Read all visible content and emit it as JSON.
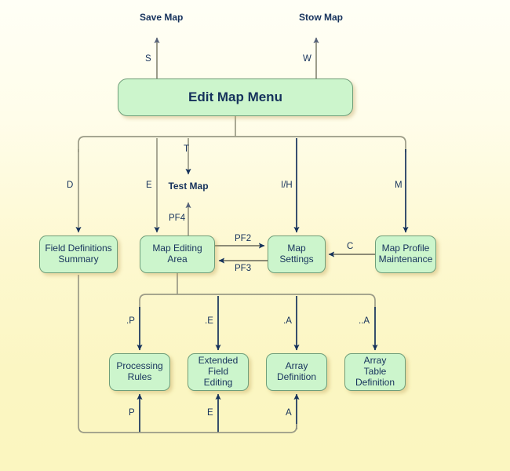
{
  "diagram": {
    "title": "Edit Map Menu navigation map",
    "colors": {
      "node_fill": "#ccf5cc",
      "node_border": "#6f9e7a",
      "text": "#16325c",
      "edge_dark": "#16325c",
      "edge_gray": "#9a9a86",
      "background_top": "#fffff6",
      "background_bottom": "#fbf6c0"
    },
    "terminals": [
      {
        "id": "save-map",
        "line1": "Save",
        "line2": "Map"
      },
      {
        "id": "stow-map",
        "line1": "Stow",
        "line2": "Map"
      },
      {
        "id": "test-map",
        "line1": "Test Map",
        "line2": ""
      }
    ],
    "nodes": [
      {
        "id": "edit-map-menu",
        "label": "Edit Map Menu"
      },
      {
        "id": "field-definitions-summary",
        "line1": "Field Definitions",
        "line2": "Summary"
      },
      {
        "id": "map-editing-area",
        "line1": "Map Editing",
        "line2": "Area"
      },
      {
        "id": "map-settings",
        "line1": "Map",
        "line2": "Settings"
      },
      {
        "id": "map-profile-maintenance",
        "line1": "Map Profile",
        "line2": "Maintenance"
      },
      {
        "id": "processing-rules",
        "line1": "Processing",
        "line2": "Rules",
        "line3": ""
      },
      {
        "id": "extended-field-editing",
        "line1": "Extended",
        "line2": "Field",
        "line3": "Editing"
      },
      {
        "id": "array-definition",
        "line1": "Array",
        "line2": "Definition",
        "line3": ""
      },
      {
        "id": "array-table-definition",
        "line1": "Array",
        "line2": "Table",
        "line3": "Definition"
      }
    ],
    "edge_labels": [
      {
        "id": "edge-label-s",
        "text": "S"
      },
      {
        "id": "edge-label-w",
        "text": "W"
      },
      {
        "id": "edge-label-d",
        "text": "D"
      },
      {
        "id": "edge-label-e",
        "text": "E"
      },
      {
        "id": "edge-label-t",
        "text": "T"
      },
      {
        "id": "edge-label-ih",
        "text": "I/H"
      },
      {
        "id": "edge-label-m",
        "text": "M"
      },
      {
        "id": "edge-label-pf4",
        "text": "PF4"
      },
      {
        "id": "edge-label-pf2",
        "text": "PF2"
      },
      {
        "id": "edge-label-pf3",
        "text": "PF3"
      },
      {
        "id": "edge-label-c",
        "text": "C"
      },
      {
        "id": "edge-label-dot-p",
        "text": ".P"
      },
      {
        "id": "edge-label-dot-e",
        "text": ".E"
      },
      {
        "id": "edge-label-dot-a",
        "text": ".A"
      },
      {
        "id": "edge-label-dotdot-a",
        "text": "..A"
      },
      {
        "id": "edge-label-p",
        "text": "P"
      },
      {
        "id": "edge-label-e2",
        "text": "E"
      },
      {
        "id": "edge-label-a",
        "text": "A"
      }
    ]
  }
}
